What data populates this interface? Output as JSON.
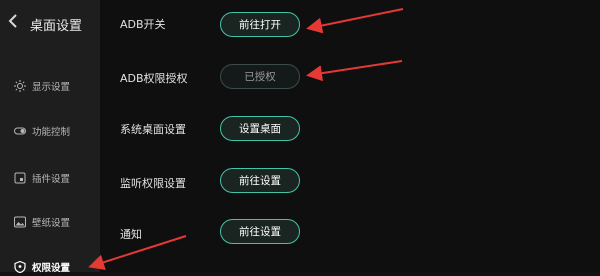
{
  "sidebar": {
    "back_icon": "chevron-left-icon",
    "title": "桌面设置",
    "items": [
      {
        "label": "显示设置",
        "icon": "sun-icon"
      },
      {
        "label": "功能控制",
        "icon": "toggle-icon"
      },
      {
        "label": "插件设置",
        "icon": "plugin-icon"
      },
      {
        "label": "壁纸设置",
        "icon": "image-icon"
      },
      {
        "label": "权限设置",
        "icon": "shield-icon",
        "active": true
      }
    ]
  },
  "rows": [
    {
      "label": "ADB开关",
      "button": "前往打开"
    },
    {
      "label": "ADB权限授权",
      "button": "已授权",
      "disabled": true
    },
    {
      "label": "系统桌面设置",
      "button": "设置桌面"
    },
    {
      "label": "监听权限设置",
      "button": "前往设置"
    },
    {
      "label": "通知",
      "button": "前往设置"
    }
  ],
  "colors": {
    "accent": "#43c4a8",
    "annotation_arrow": "#e53935",
    "sidebar_bg": "#1e1e1e",
    "main_bg": "#0f0f0f"
  }
}
